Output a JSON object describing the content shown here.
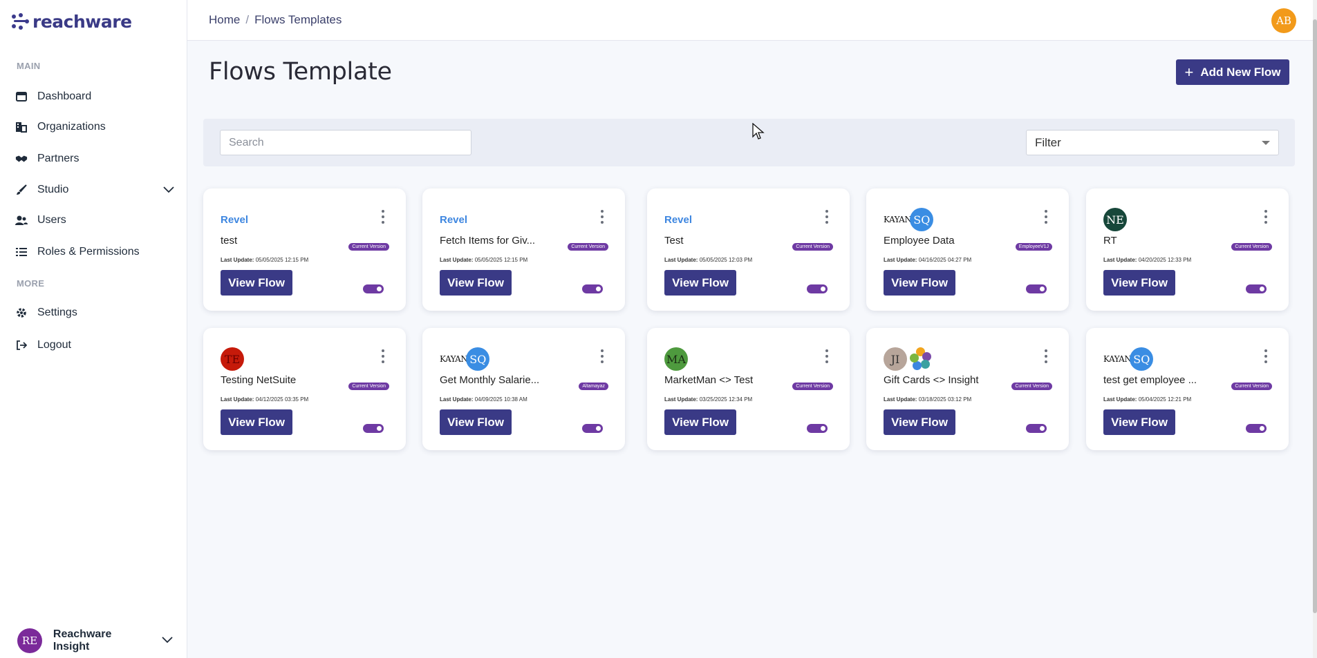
{
  "brand": {
    "name": "reachware"
  },
  "sidebar": {
    "sections": {
      "main": "MAIN",
      "more": "MORE"
    },
    "items": [
      {
        "label": "Dashboard",
        "icon": "dashboard-icon"
      },
      {
        "label": "Organizations",
        "icon": "organizations-icon"
      },
      {
        "label": "Partners",
        "icon": "handshake-icon"
      },
      {
        "label": "Studio",
        "icon": "brush-icon"
      },
      {
        "label": "Users",
        "icon": "users-icon"
      },
      {
        "label": "Roles & Permissions",
        "icon": "list-check-icon"
      },
      {
        "label": "Settings",
        "icon": "gear-icon"
      },
      {
        "label": "Logout",
        "icon": "logout-icon"
      }
    ],
    "user": {
      "initials": "RE",
      "name": "Reachware Insight"
    }
  },
  "header": {
    "breadcrumb": [
      "Home",
      "/",
      "Flows Templates"
    ],
    "avatar": "AB"
  },
  "main": {
    "title": "Flows Template",
    "add_button": "Add New Flow",
    "search_placeholder": "Search",
    "filter_label": "Filter",
    "view_label": "View Flow",
    "last_update_label": "Last Update:"
  },
  "cards": [
    {
      "brand": "Revel",
      "title": "test",
      "badge": "Current Version",
      "updated": "05/05/2025 12:15 PM",
      "enabled": true
    },
    {
      "brand": "Revel",
      "title": "Fetch Items for Giv...",
      "badge": "Current Version",
      "updated": "05/05/2025 12:15 PM",
      "enabled": true
    },
    {
      "brand": "Revel",
      "title": "Test",
      "badge": "Current Version",
      "updated": "05/05/2025 12:03 PM",
      "enabled": true
    },
    {
      "brand_prefix": "KAYAN",
      "avatar": "SQ",
      "title": "Employee Data",
      "badge": "EmployeeV1J",
      "updated": "04/16/2025 04:27 PM",
      "enabled": true
    },
    {
      "avatar": "NE",
      "title": "RT",
      "badge": "Current Version",
      "updated": "04/20/2025 12:33 PM",
      "enabled": true
    },
    {
      "avatar": "TE",
      "title": "Testing NetSuite",
      "badge": "Current Version",
      "updated": "04/12/2025 03:35 PM",
      "enabled": true
    },
    {
      "brand_prefix": "KAYAN",
      "avatar": "SQ",
      "title": "Get Monthly Salarie...",
      "badge": "Altamayaz",
      "updated": "04/09/2025 10:38 AM",
      "enabled": true
    },
    {
      "avatar": "MA",
      "title": "MarketMan <> Test",
      "badge": "Current Version",
      "updated": "03/25/2025 12:34 PM",
      "enabled": true
    },
    {
      "avatar": "JI",
      "title": "Gift Cards <> Insight",
      "badge": "Current Version",
      "updated": "03/18/2025 03:12 PM",
      "enabled": true
    },
    {
      "brand_prefix": "KAYAN",
      "avatar": "SQ",
      "title": "test get employee ...",
      "badge": "Current Version",
      "updated": "05/04/2025 12:21 PM",
      "enabled": true
    }
  ],
  "colors": {
    "primary": "#3a3a86",
    "badge": "#6e3aa3",
    "revel": "#3d86e0",
    "avatar_ab": "#f29a1a",
    "avatar_re": "#7b2a9a"
  }
}
